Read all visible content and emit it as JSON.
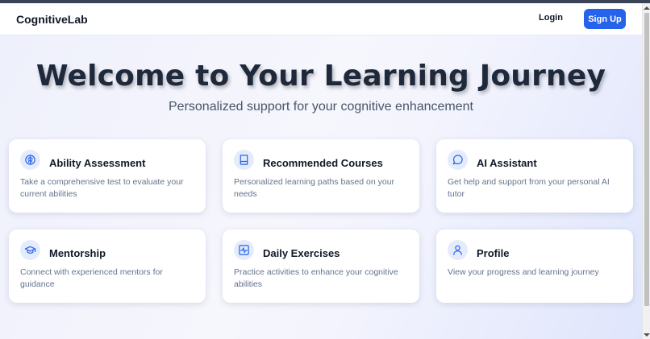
{
  "header": {
    "brand": "CognitiveLab",
    "login_label": "Login",
    "signup_label": "Sign Up"
  },
  "hero": {
    "title": "Welcome to Your Learning Journey",
    "subtitle": "Personalized support for your cognitive enhancement"
  },
  "cards": [
    {
      "icon": "brain-icon",
      "title": "Ability Assessment",
      "description": "Take a comprehensive test to evaluate your current abilities"
    },
    {
      "icon": "book-icon",
      "title": "Recommended Courses",
      "description": "Personalized learning paths based on your needs"
    },
    {
      "icon": "chat-bubble-icon",
      "title": "AI Assistant",
      "description": "Get help and support from your personal AI tutor"
    },
    {
      "icon": "graduation-cap-icon",
      "title": "Mentorship",
      "description": "Connect with experienced mentors for guidance"
    },
    {
      "icon": "activity-icon",
      "title": "Daily Exercises",
      "description": "Practice activities to enhance your cognitive abilities"
    },
    {
      "icon": "user-icon",
      "title": "Profile",
      "description": "View your progress and learning journey"
    }
  ],
  "colors": {
    "accent": "#2563eb",
    "icon_bg": "#e4ebfb",
    "title": "#1e293b",
    "text_muted": "#64748b"
  }
}
